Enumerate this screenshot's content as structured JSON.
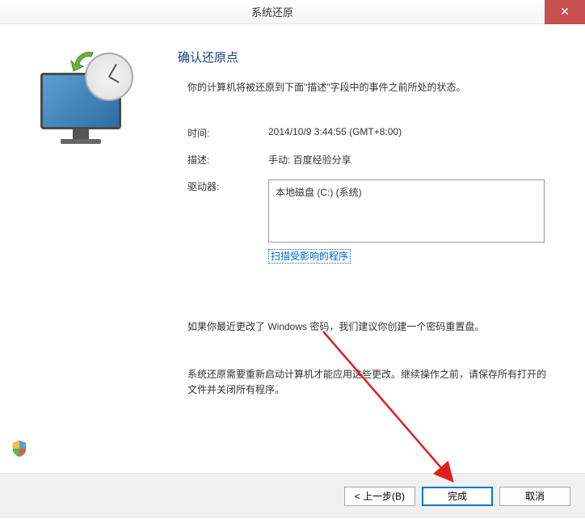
{
  "window": {
    "title": "系统还原"
  },
  "main": {
    "heading": "确认还原点",
    "intro": "你的计算机将被还原到下面\"描述\"字段中的事件之前所处的状态。",
    "fields": {
      "time_label": "时间:",
      "time_value": "2014/10/9 3:44:55 (GMT+8:00)",
      "desc_label": "描述:",
      "desc_value": "手动: 百度经验分享",
      "drive_label": "驱动器:",
      "drive_value": "本地磁盘 (C:) (系统)"
    },
    "scan_link": "扫描受影响的程序",
    "password_note": "如果你最近更改了 Windows 密码，我们建议你创建一个密码重置盘。",
    "restart_warning": "系统还原需要重新启动计算机才能应用这些更改。继续操作之前，请保存所有打开的文件并关闭所有程序。"
  },
  "buttons": {
    "back": "< 上一步(B)",
    "finish": "完成",
    "cancel": "取消"
  }
}
